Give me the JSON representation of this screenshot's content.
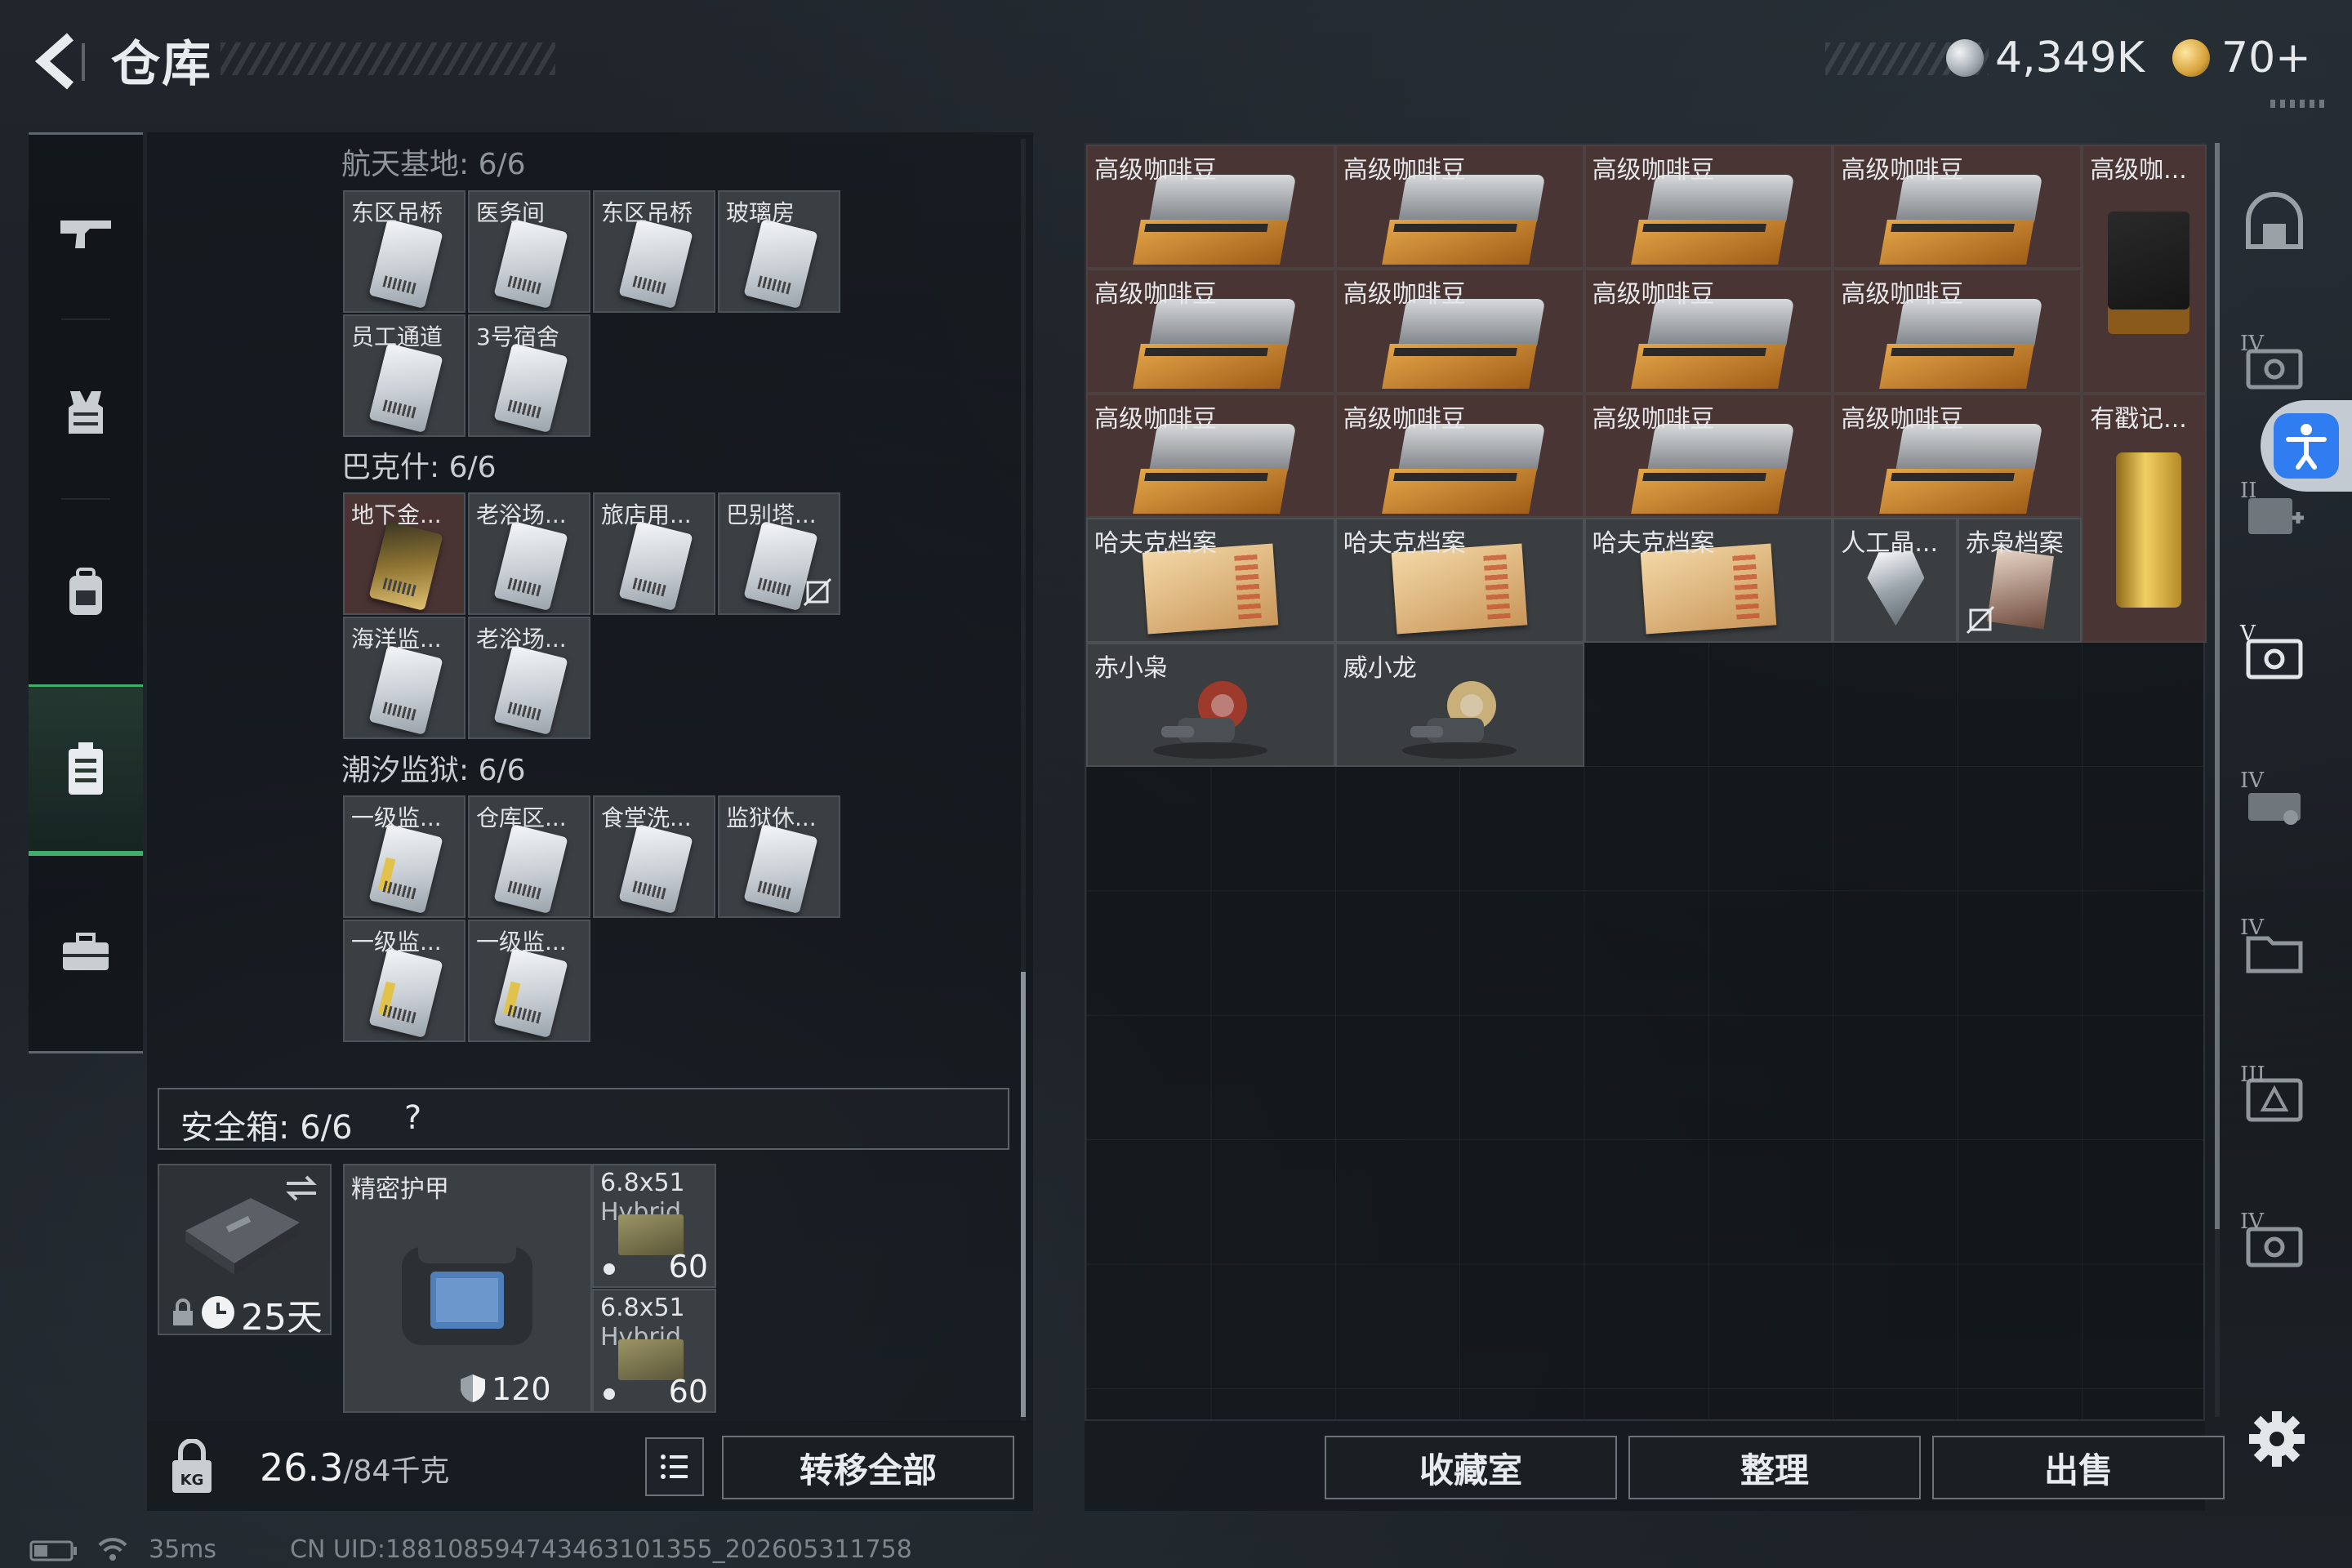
{
  "header": {
    "title": "仓库",
    "currency_silver": "4,349K",
    "currency_gold": "70+"
  },
  "sidebar": {
    "items": [
      {
        "name": "weapons",
        "icon": "rifle-icon"
      },
      {
        "name": "armor",
        "icon": "vest-icon"
      },
      {
        "name": "backpack",
        "icon": "backpack-icon"
      },
      {
        "name": "keys",
        "icon": "keycard-case-icon",
        "active": true
      },
      {
        "name": "toolbox",
        "icon": "briefcase-icon"
      }
    ]
  },
  "key_groups": [
    {
      "title": "航天基地: 6/6",
      "items": [
        {
          "label": "东区吊桥",
          "style": "silver"
        },
        {
          "label": "医务间",
          "style": "silver"
        },
        {
          "label": "东区吊桥",
          "style": "silver"
        },
        {
          "label": "玻璃房",
          "style": "silver"
        },
        {
          "label": "员工通道",
          "style": "silver"
        },
        {
          "label": "3号宿舍",
          "style": "silver"
        }
      ]
    },
    {
      "title": "巴克什: 6/6",
      "items": [
        {
          "label": "地下金...",
          "style": "gold"
        },
        {
          "label": "老浴场...",
          "style": "silver"
        },
        {
          "label": "旅店用...",
          "style": "silver"
        },
        {
          "label": "巴别塔...",
          "style": "silver",
          "no_copy": true
        },
        {
          "label": "海洋监...",
          "style": "silver"
        },
        {
          "label": "老浴场...",
          "style": "silver"
        }
      ]
    },
    {
      "title": "潮汐监狱: 6/6",
      "items": [
        {
          "label": "一级监...",
          "style": "yellow"
        },
        {
          "label": "仓库区...",
          "style": "silver"
        },
        {
          "label": "食堂洗...",
          "style": "silver"
        },
        {
          "label": "监狱休...",
          "style": "silver"
        },
        {
          "label": "一级监...",
          "style": "yellow"
        },
        {
          "label": "一级监...",
          "style": "yellow"
        }
      ]
    }
  ],
  "safe_box": {
    "title": "安全箱: 6/6",
    "help": "?",
    "case_days": "25天",
    "armor_label": "精密护甲",
    "armor_value": "120",
    "ammo": [
      {
        "line1": "6.8x51",
        "line2": "Hybrid",
        "count": "60"
      },
      {
        "line1": "6.8x51",
        "line2": "Hybrid",
        "count": "60"
      }
    ]
  },
  "footer_left": {
    "weight": "26.3",
    "weight_cap": "/84千克",
    "transfer_all": "转移全部"
  },
  "stash_items": [
    {
      "label": "高级咖啡豆",
      "kind": "coffee"
    },
    {
      "label": "高级咖啡豆",
      "kind": "coffee"
    },
    {
      "label": "高级咖啡豆",
      "kind": "coffee"
    },
    {
      "label": "高级咖啡豆",
      "kind": "coffee"
    },
    {
      "label": "高级咖...",
      "kind": "coffee-tall"
    },
    {
      "label": "高级咖啡豆",
      "kind": "coffee"
    },
    {
      "label": "高级咖啡豆",
      "kind": "coffee"
    },
    {
      "label": "高级咖啡豆",
      "kind": "coffee"
    },
    {
      "label": "高级咖啡豆",
      "kind": "coffee"
    },
    {
      "label": "高级咖啡豆",
      "kind": "coffee"
    },
    {
      "label": "高级咖啡豆",
      "kind": "coffee"
    },
    {
      "label": "高级咖啡豆",
      "kind": "coffee"
    },
    {
      "label": "高级咖啡豆",
      "kind": "coffee"
    },
    {
      "label": "有戳记...",
      "kind": "gold-bar"
    },
    {
      "label": "哈夫克档案",
      "kind": "folder"
    },
    {
      "label": "哈夫克档案",
      "kind": "folder"
    },
    {
      "label": "哈夫克档案",
      "kind": "folder"
    },
    {
      "label": "人工晶...",
      "kind": "gem"
    },
    {
      "label": "赤枭档案",
      "kind": "red-file",
      "no_copy": true
    },
    {
      "label": "赤小枭",
      "kind": "figure-red"
    },
    {
      "label": "威小龙",
      "kind": "figure-gold"
    }
  ],
  "footer_right": {
    "collection": "收藏室",
    "organize": "整理",
    "sell": "出售"
  },
  "status_bar": {
    "ping": "35ms",
    "uid": "CN UID:188108594743463101355_202605311758"
  }
}
